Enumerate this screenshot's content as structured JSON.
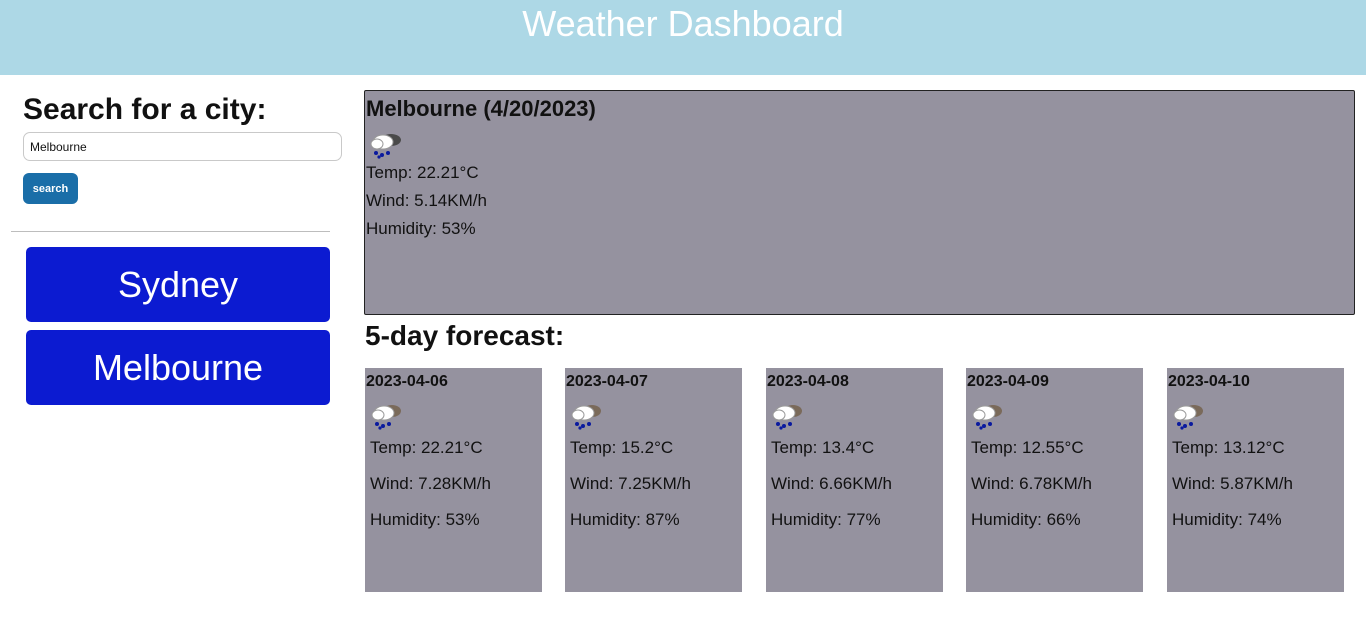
{
  "header": {
    "title": "Weather Dashboard"
  },
  "sidebar": {
    "heading": "Search for a city:",
    "search_value": "Melbourne",
    "search_button": "search",
    "history": [
      {
        "label": "Sydney"
      },
      {
        "label": "Melbourne"
      }
    ]
  },
  "current": {
    "title": "Melbourne (4/20/2023)",
    "icon": "rain-cloud-icon",
    "temp": "Temp: 22.21°C",
    "wind": "Wind: 5.14KM/h",
    "humidity": "Humidity: 53%"
  },
  "forecast": {
    "heading": "5-day forecast:",
    "days": [
      {
        "date": "2023-04-06",
        "icon": "rain-cloud-icon",
        "temp": "Temp: 22.21°C",
        "wind": "Wind: 7.28KM/h",
        "humidity": "Humidity: 53%"
      },
      {
        "date": "2023-04-07",
        "icon": "rain-cloud-icon",
        "temp": "Temp: 15.2°C",
        "wind": "Wind: 7.25KM/h",
        "humidity": "Humidity: 87%"
      },
      {
        "date": "2023-04-08",
        "icon": "rain-cloud-icon",
        "temp": "Temp: 13.4°C",
        "wind": "Wind: 6.66KM/h",
        "humidity": "Humidity: 77%"
      },
      {
        "date": "2023-04-09",
        "icon": "rain-cloud-icon",
        "temp": "Temp: 12.55°C",
        "wind": "Wind: 6.78KM/h",
        "humidity": "Humidity: 66%"
      },
      {
        "date": "2023-04-10",
        "icon": "rain-cloud-icon",
        "temp": "Temp: 13.12°C",
        "wind": "Wind: 5.87KM/h",
        "humidity": "Humidity: 74%"
      }
    ]
  },
  "colors": {
    "header_bg": "#add8e6",
    "card_bg": "#95929f",
    "history_button_bg": "#0c1bd1",
    "search_button_bg": "#1a6ea8"
  }
}
